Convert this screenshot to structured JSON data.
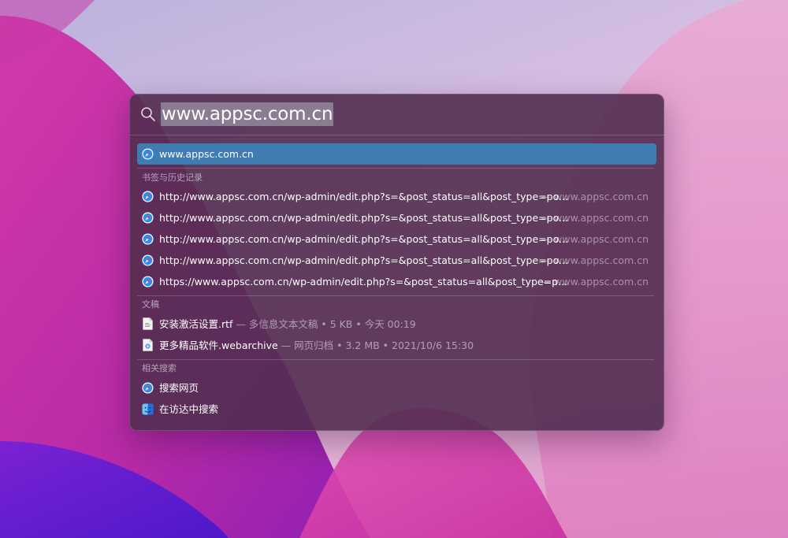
{
  "search": {
    "query": "www.appsc.com.cn"
  },
  "top_hit": {
    "label": "www.appsc.com.cn",
    "icon": "safari-icon"
  },
  "sections": {
    "bookmarks": {
      "title": "书签与历史记录",
      "items": [
        {
          "title": "http://www.appsc.com.cn/wp-admin/edit.php?s=&post_status=all&post_type=po...",
          "trail": "— www.appsc.com.cn",
          "icon": "safari-icon"
        },
        {
          "title": "http://www.appsc.com.cn/wp-admin/edit.php?s=&post_status=all&post_type=po...",
          "trail": "— www.appsc.com.cn",
          "icon": "safari-icon"
        },
        {
          "title": "http://www.appsc.com.cn/wp-admin/edit.php?s=&post_status=all&post_type=po...",
          "trail": "— www.appsc.com.cn",
          "icon": "safari-icon"
        },
        {
          "title": "http://www.appsc.com.cn/wp-admin/edit.php?s=&post_status=all&post_type=po...",
          "trail": "— www.appsc.com.cn",
          "icon": "safari-icon"
        },
        {
          "title": "https://www.appsc.com.cn/wp-admin/edit.php?s=&post_status=all&post_type=p...",
          "trail": "— www.appsc.com.cn",
          "icon": "safari-icon"
        }
      ]
    },
    "documents": {
      "title": "文稿",
      "items": [
        {
          "title": "安装激活设置.rtf",
          "meta": " — 多信息文本文稿 • 5 KB • 今天 00:19",
          "icon": "rtf-document-icon"
        },
        {
          "title": "更多精品软件.webarchive",
          "meta": " — 网页归档 • 3.2 MB • 2021/10/6 15:30",
          "icon": "webarchive-document-icon"
        }
      ]
    },
    "related": {
      "title": "相关搜索",
      "items": [
        {
          "title": "搜索网页",
          "icon": "safari-icon"
        },
        {
          "title": "在访达中搜索",
          "icon": "finder-icon"
        }
      ]
    }
  },
  "colors": {
    "selection": "#3e7cb1",
    "panel": "#522e50",
    "wallpaper_magenta": "#c42fa8",
    "wallpaper_purple": "#6a1fd0"
  }
}
